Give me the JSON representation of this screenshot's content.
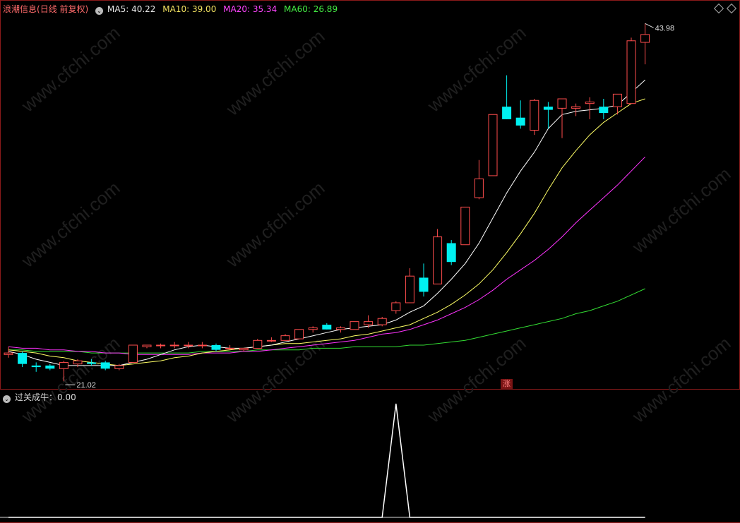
{
  "main": {
    "name": "浪潮信息",
    "period": "(日线 前复权)",
    "ma5_label": "MA5: 40.22",
    "ma10_label": "MA10: 39.00",
    "ma20_label": "MA20: 35.34",
    "ma60_label": "MA60: 26.89",
    "high_label": "43.98",
    "low_label": "21.02",
    "zhang": "涨"
  },
  "indicator": {
    "label": "过关成牛：0.00"
  },
  "colors": {
    "up": "#ff4d4d",
    "down": "#00f0f0",
    "ma5": "#ffffff",
    "ma10": "#ffff66",
    "ma20": "#ff33ff",
    "ma60": "#33dd33",
    "ma5_text": "#e6e6e6",
    "ma10_text": "#f0e060",
    "ma20_text": "#ff44ff",
    "ma60_text": "#44ee44"
  },
  "chart_data": {
    "type": "candlestick",
    "y_range": [
      20.6,
      44.4
    ],
    "candles": [
      [
        22.7,
        23.2,
        22.5,
        22.8
      ],
      [
        22.8,
        22.9,
        21.9,
        22.1
      ],
      [
        22.0,
        22.2,
        21.6,
        21.9
      ],
      [
        22.0,
        22.1,
        21.7,
        21.8
      ],
      [
        21.8,
        22.3,
        21.0,
        22.2
      ],
      [
        22.1,
        22.4,
        21.9,
        22.3
      ],
      [
        22.2,
        22.4,
        22.0,
        22.1
      ],
      [
        22.2,
        22.3,
        21.7,
        21.8
      ],
      [
        21.8,
        22.1,
        21.7,
        22.0
      ],
      [
        22.2,
        23.3,
        22.2,
        23.3
      ],
      [
        23.2,
        23.3,
        23.1,
        23.3
      ],
      [
        23.3,
        23.4,
        23.1,
        23.3
      ],
      [
        23.3,
        23.5,
        23.1,
        23.3
      ],
      [
        23.3,
        23.5,
        23.1,
        23.3
      ],
      [
        23.3,
        23.5,
        23.1,
        23.3
      ],
      [
        23.3,
        23.4,
        22.9,
        23.0
      ],
      [
        23.1,
        23.3,
        23.0,
        23.1
      ],
      [
        23.0,
        23.1,
        22.9,
        23.1
      ],
      [
        23.1,
        23.7,
        23.1,
        23.6
      ],
      [
        23.6,
        23.8,
        23.5,
        23.6
      ],
      [
        23.6,
        24.0,
        23.6,
        23.9
      ],
      [
        23.7,
        24.3,
        23.7,
        24.3
      ],
      [
        24.3,
        24.5,
        24.1,
        24.4
      ],
      [
        24.6,
        24.7,
        24.3,
        24.3
      ],
      [
        24.3,
        24.5,
        24.1,
        24.4
      ],
      [
        24.3,
        24.8,
        24.3,
        24.8
      ],
      [
        24.6,
        25.2,
        24.4,
        24.8
      ],
      [
        24.6,
        25.1,
        24.5,
        25.0
      ],
      [
        25.5,
        26.1,
        25.3,
        26.0
      ],
      [
        26.0,
        28.2,
        26.0,
        27.7
      ],
      [
        27.6,
        28.5,
        26.4,
        26.7
      ],
      [
        27.2,
        30.7,
        27.2,
        30.2
      ],
      [
        29.8,
        30.0,
        28.4,
        28.6
      ],
      [
        29.7,
        31.6,
        29.7,
        32.1
      ],
      [
        32.7,
        35.1,
        32.6,
        33.9
      ],
      [
        34.1,
        38.0,
        34.1,
        38.0
      ],
      [
        38.5,
        40.5,
        37.7,
        37.7
      ],
      [
        37.8,
        38.9,
        37.1,
        37.3
      ],
      [
        37.0,
        39.0,
        36.7,
        38.9
      ],
      [
        38.5,
        38.8,
        37.1,
        38.3
      ],
      [
        38.4,
        39.0,
        36.5,
        39.0
      ],
      [
        38.4,
        38.7,
        37.9,
        38.5
      ],
      [
        38.7,
        39.1,
        37.7,
        38.8
      ],
      [
        38.5,
        39.0,
        37.7,
        38.1
      ],
      [
        38.5,
        39.3,
        38.0,
        39.3
      ],
      [
        38.7,
        42.9,
        38.7,
        42.7
      ],
      [
        42.6,
        43.8,
        41.2,
        43.1
      ]
    ],
    "ma5": [
      22.9,
      22.7,
      22.4,
      22.2,
      22.0,
      22.0,
      22.0,
      22.0,
      22.0,
      22.2,
      22.4,
      22.7,
      23.0,
      23.2,
      23.3,
      23.2,
      23.1,
      23.1,
      23.2,
      23.3,
      23.5,
      23.7,
      23.9,
      24.1,
      24.3,
      24.4,
      24.5,
      24.6,
      24.9,
      25.4,
      25.8,
      26.6,
      27.5,
      28.5,
      29.8,
      31.4,
      33.0,
      34.4,
      35.6,
      37.1,
      38.0,
      38.2,
      38.3,
      38.4,
      38.6,
      39.4,
      40.2
    ],
    "ma10": [
      23.0,
      22.9,
      22.8,
      22.6,
      22.5,
      22.3,
      22.2,
      22.1,
      22.0,
      22.1,
      22.2,
      22.3,
      22.5,
      22.6,
      22.8,
      22.9,
      23.0,
      23.1,
      23.2,
      23.3,
      23.4,
      23.4,
      23.5,
      23.6,
      23.7,
      23.9,
      24.0,
      24.2,
      24.4,
      24.6,
      25.0,
      25.4,
      25.9,
      26.5,
      27.2,
      28.1,
      29.2,
      30.4,
      31.7,
      33.2,
      34.6,
      35.7,
      36.7,
      37.5,
      38.1,
      38.7,
      39.0
    ],
    "ma20": [
      23.2,
      23.1,
      23.1,
      23.0,
      23.0,
      22.9,
      22.9,
      22.8,
      22.8,
      22.7,
      22.7,
      22.7,
      22.7,
      22.7,
      22.8,
      22.8,
      22.8,
      22.9,
      22.9,
      23.0,
      23.1,
      23.2,
      23.3,
      23.4,
      23.5,
      23.6,
      23.8,
      24.0,
      24.1,
      24.3,
      24.6,
      24.9,
      25.3,
      25.7,
      26.2,
      26.8,
      27.5,
      28.1,
      28.7,
      29.4,
      30.2,
      31.1,
      31.9,
      32.7,
      33.5,
      34.4,
      35.3
    ],
    "ma60": [
      23.0,
      23.0,
      22.9,
      22.9,
      22.9,
      22.9,
      22.8,
      22.8,
      22.8,
      22.8,
      22.8,
      22.8,
      22.8,
      22.8,
      22.9,
      22.9,
      22.9,
      22.9,
      23.0,
      23.0,
      23.0,
      23.0,
      23.1,
      23.1,
      23.1,
      23.2,
      23.2,
      23.2,
      23.2,
      23.3,
      23.3,
      23.4,
      23.5,
      23.6,
      23.8,
      24.0,
      24.2,
      24.4,
      24.6,
      24.8,
      25.0,
      25.3,
      25.5,
      25.8,
      26.1,
      26.5,
      26.9
    ],
    "indicator_values": [
      0,
      0,
      0,
      0,
      0,
      0,
      0,
      0,
      0,
      0,
      0,
      0,
      0,
      0,
      0,
      0,
      0,
      0,
      0,
      0,
      0,
      0,
      0,
      0,
      0,
      0,
      0,
      0,
      1,
      0,
      0,
      0,
      0,
      0,
      0,
      0,
      0,
      0,
      0,
      0,
      0,
      0,
      0,
      0,
      0,
      0,
      0
    ],
    "max_mark": "43.98",
    "min_mark": "21.02"
  }
}
